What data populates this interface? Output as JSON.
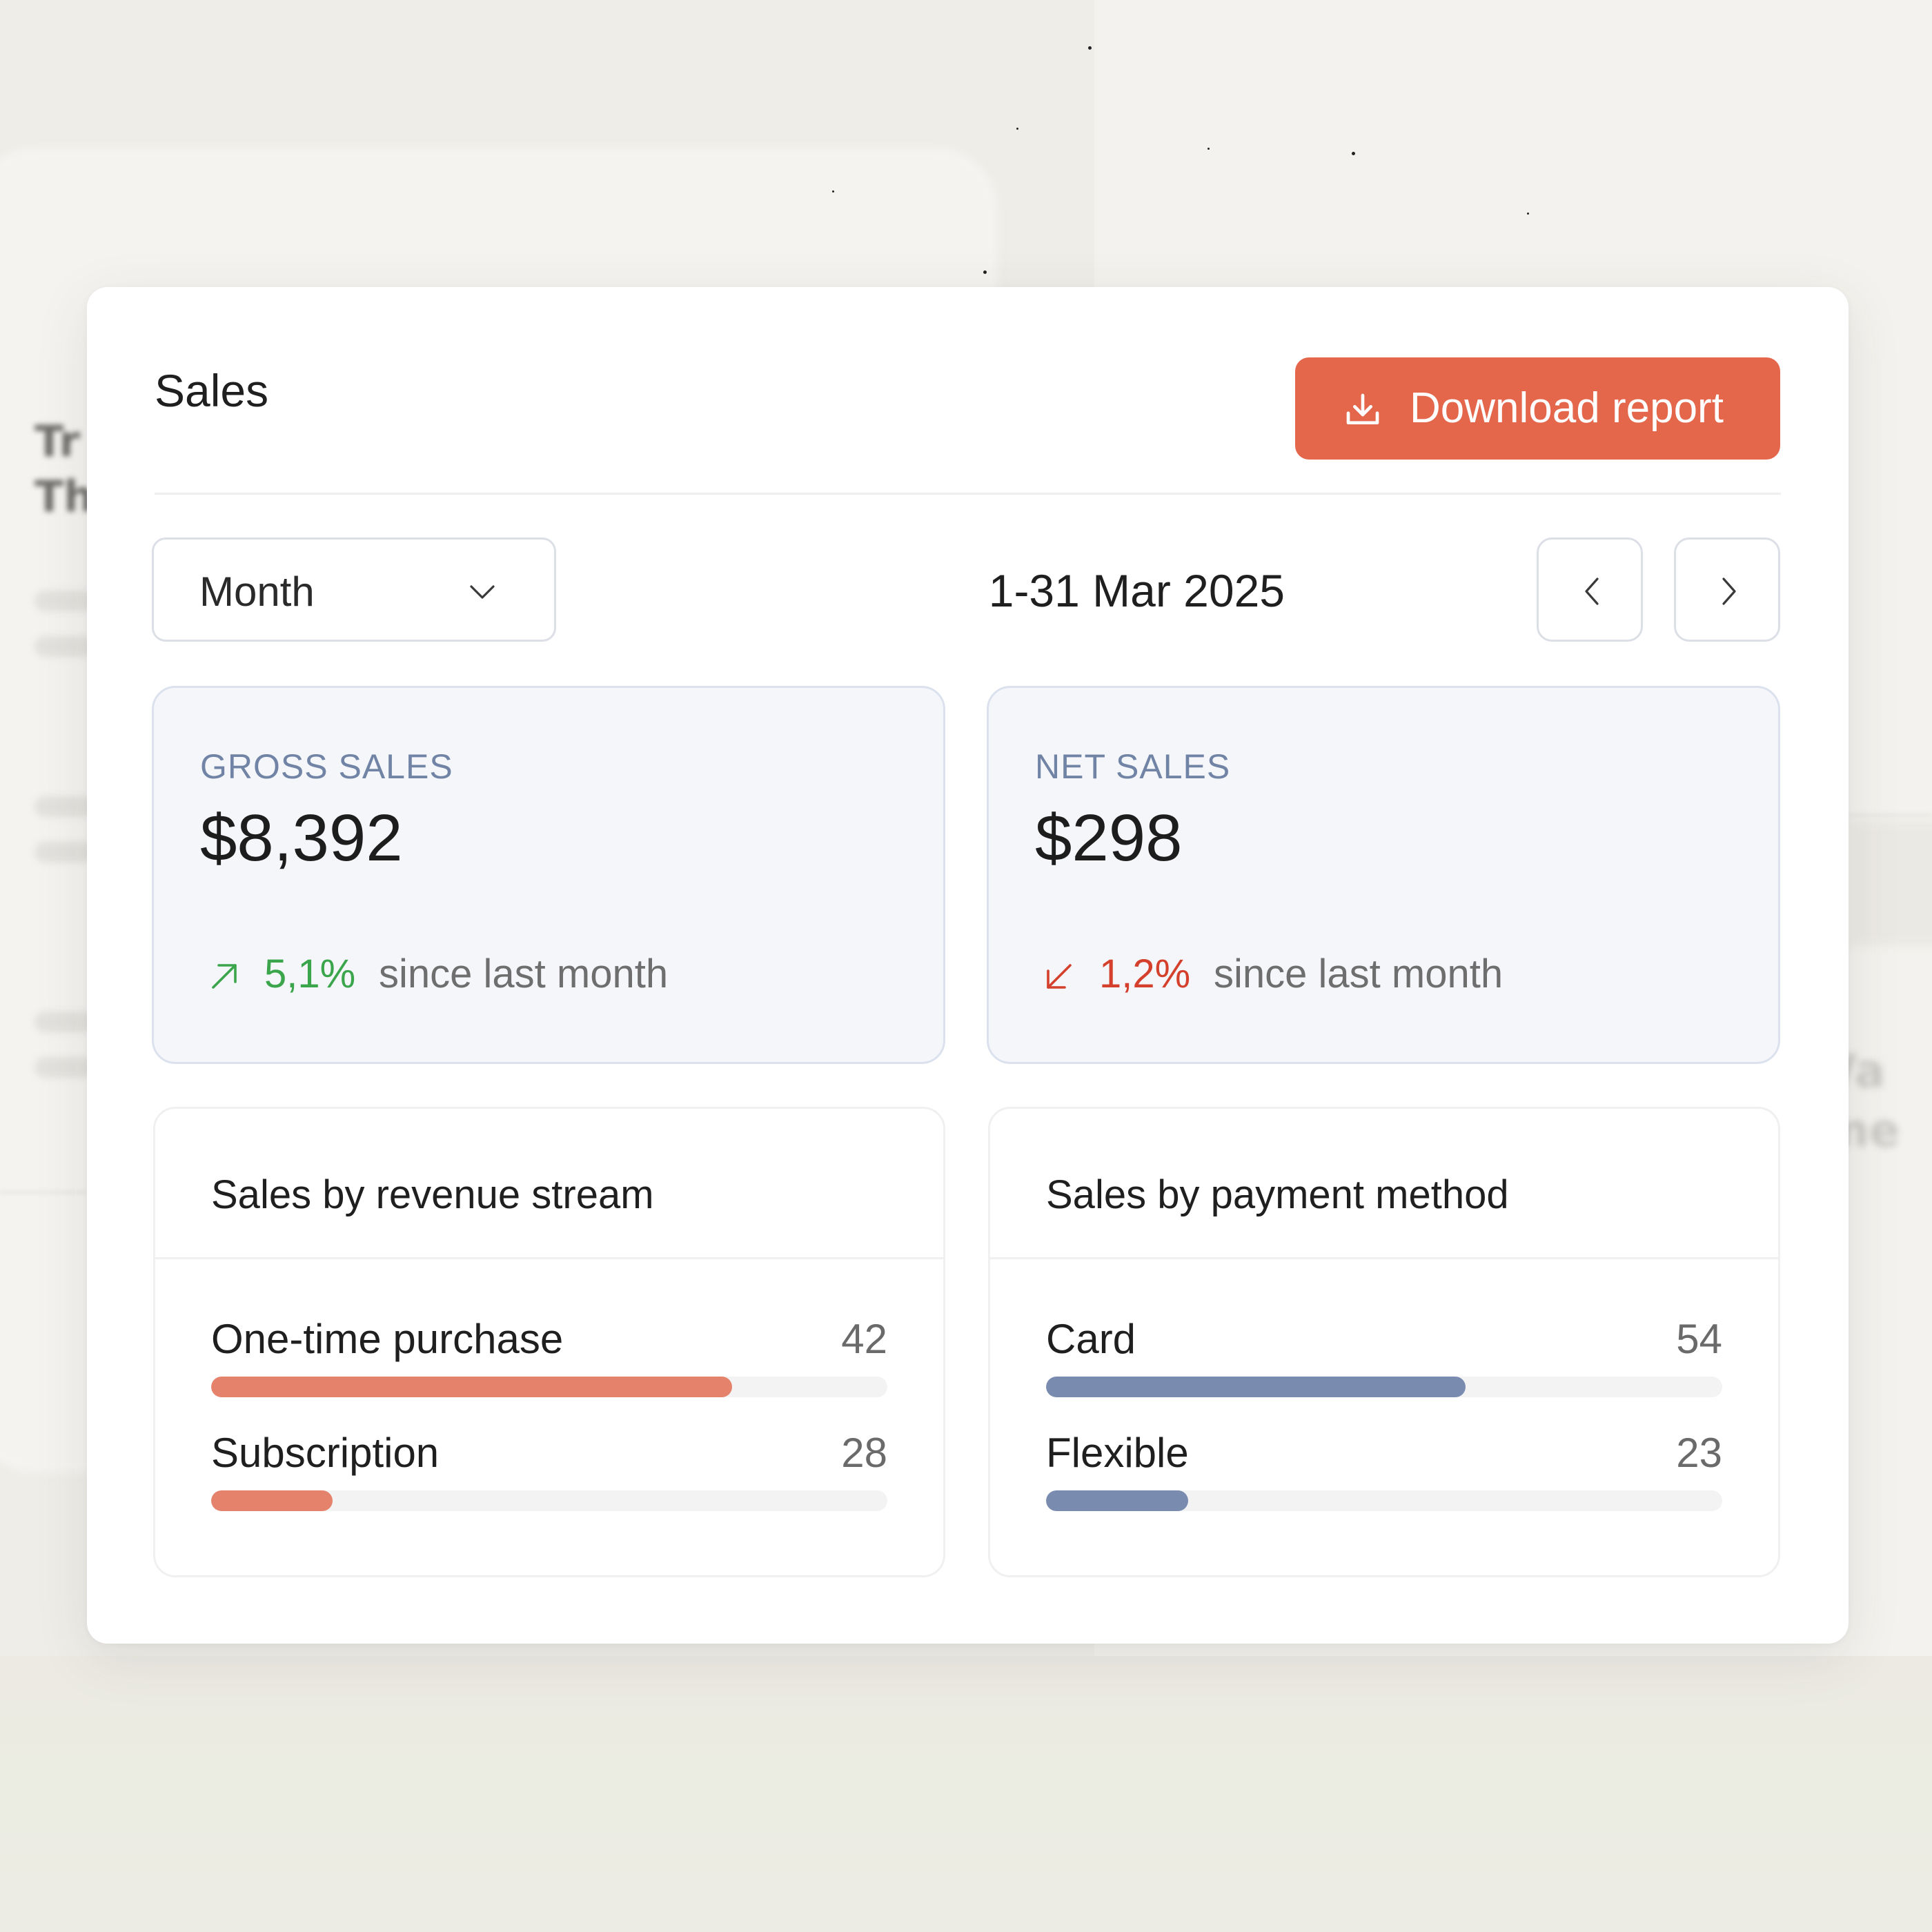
{
  "sales": {
    "title": "Sales",
    "download_label": "Download report",
    "period_select": "Month",
    "date_range": "1-31 Mar 2025"
  },
  "stats": {
    "gross": {
      "label": "GROSS SALES",
      "value": "$8,392",
      "change": "5,1%",
      "change_text": "since last month",
      "direction": "up",
      "icon": "arrow-up-right-icon"
    },
    "net": {
      "label": "NET SALES",
      "value": "$298",
      "change": "1,2%",
      "change_text": "since last month",
      "direction": "down",
      "icon": "arrow-down-left-icon"
    }
  },
  "revenue_stream": {
    "title": "Sales by revenue stream",
    "max": 54,
    "color": "#e5826b",
    "items": [
      {
        "label": "One-time purchase",
        "value": 42,
        "display": "42",
        "fraction": 0.77
      },
      {
        "label": "Subscription",
        "value": 28,
        "display": "28",
        "fraction": 0.18
      }
    ]
  },
  "payment_method": {
    "title": "Sales by payment method",
    "color": "#7a8bb0",
    "items": [
      {
        "label": "Card",
        "value": 54,
        "display": "54",
        "fraction": 0.62
      },
      {
        "label": "Flexible",
        "value": 23,
        "display": "23",
        "fraction": 0.21
      }
    ]
  },
  "colors": {
    "accent": "#e4664b",
    "up": "#3aa54a",
    "down": "#d4402c"
  },
  "icons": {
    "download": "download-icon",
    "dropdown": "chevron-down-icon",
    "prev": "chevron-left-icon",
    "next": "chevron-right-icon"
  }
}
